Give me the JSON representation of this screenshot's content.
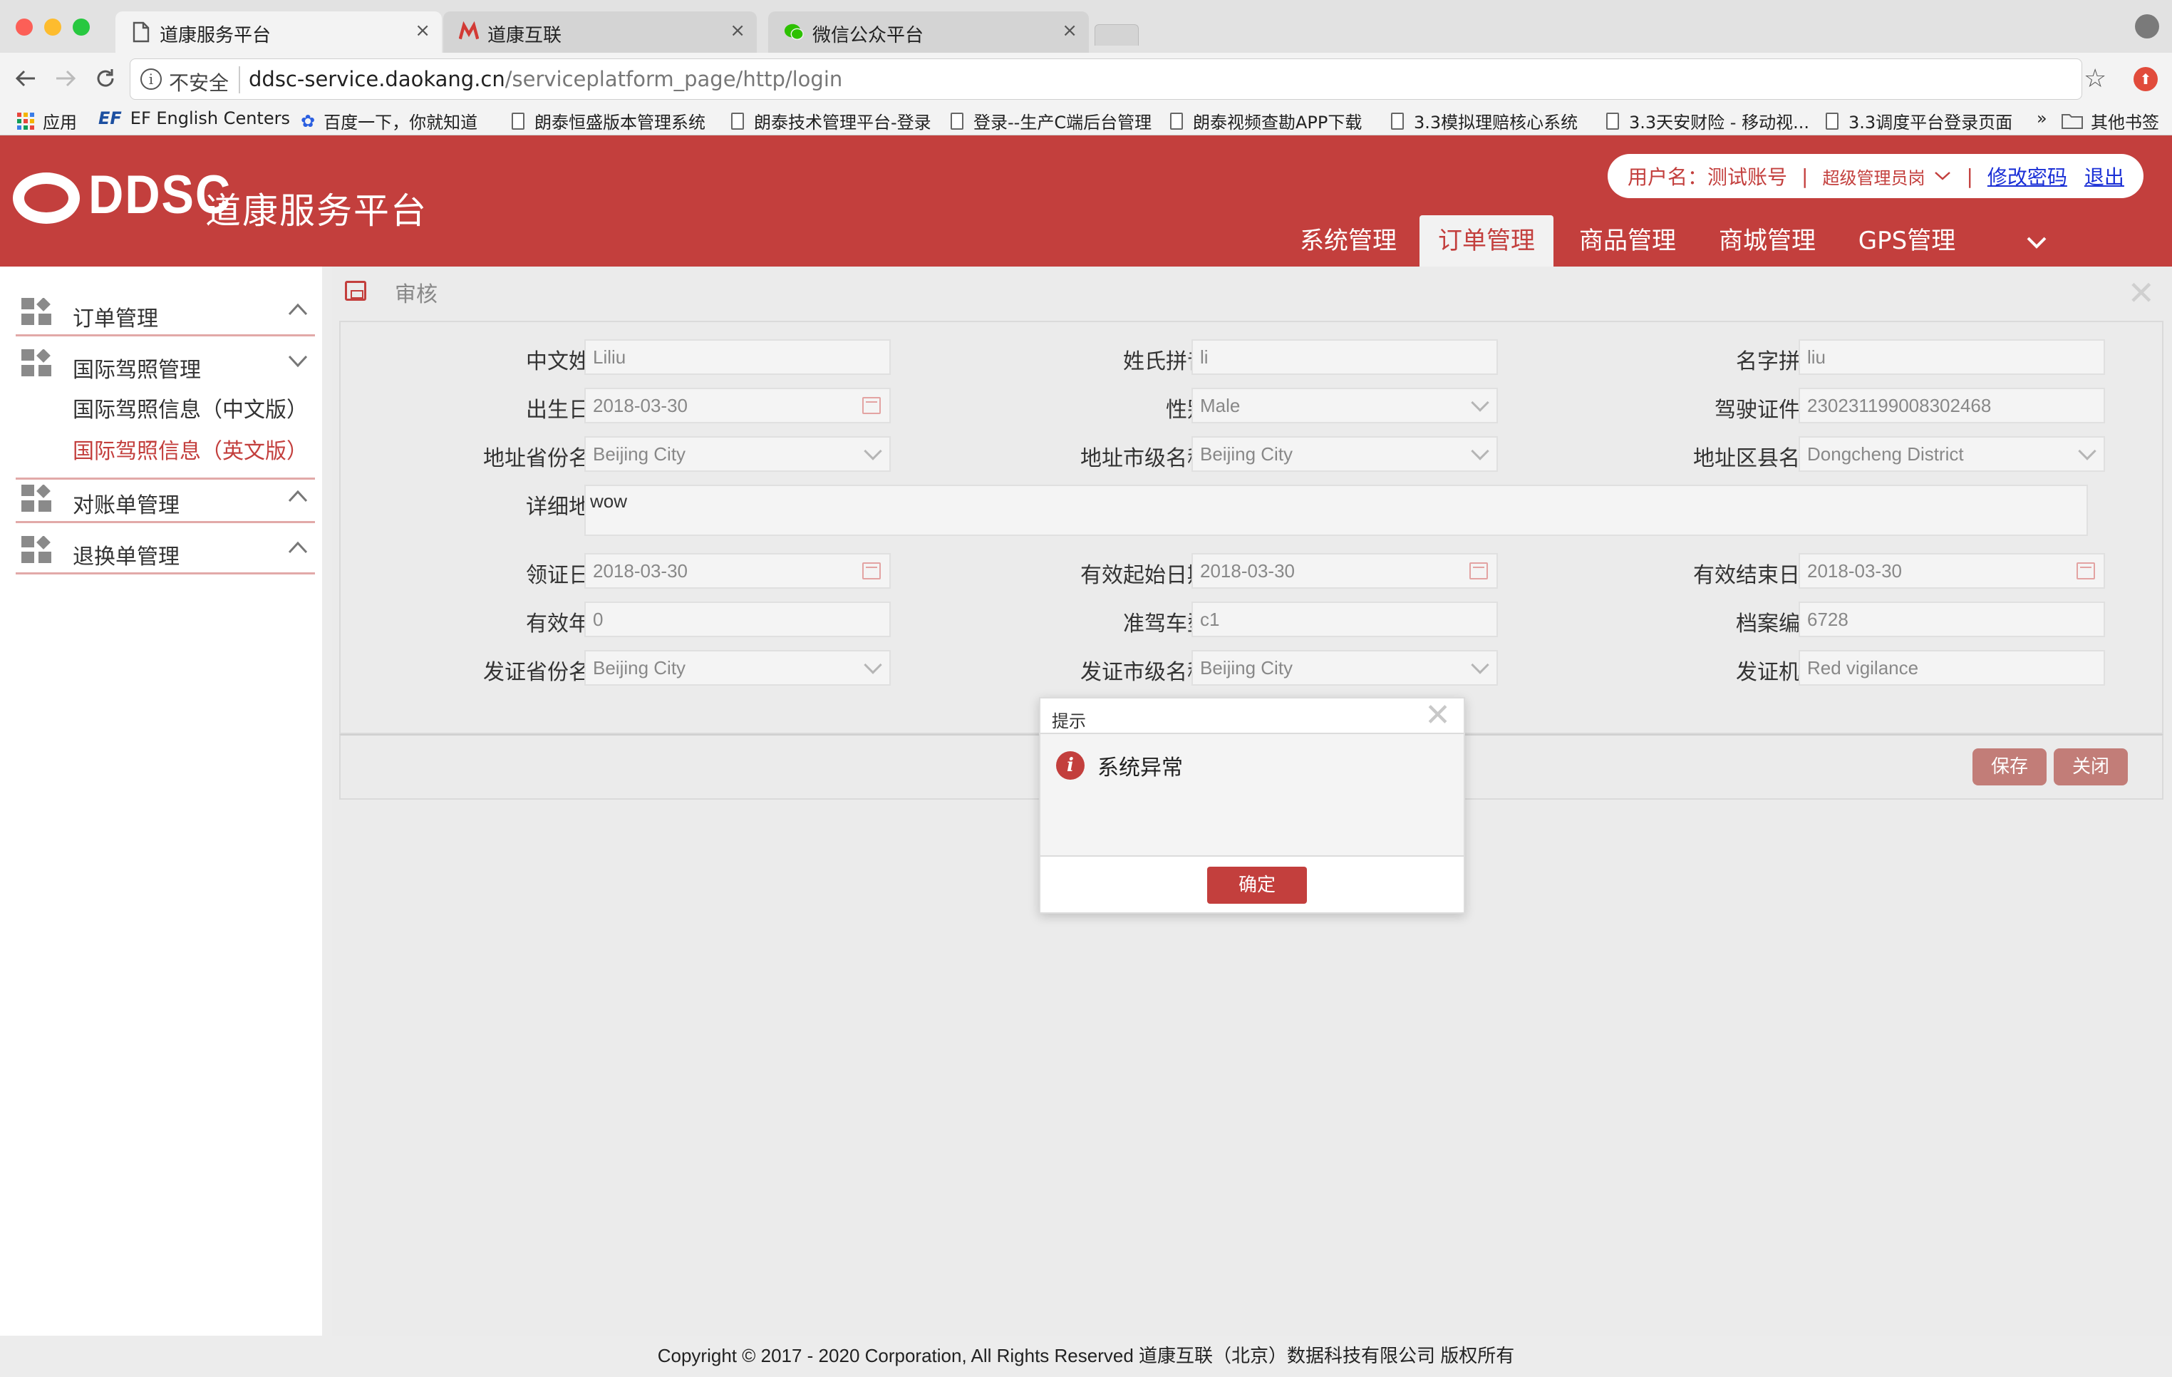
{
  "browser": {
    "tabs": [
      {
        "title": "道康服务平台",
        "active": true
      },
      {
        "title": "道康互联",
        "active": false
      },
      {
        "title": "微信公众平台",
        "active": false
      }
    ],
    "close_glyph": "×",
    "security": "不安全",
    "url_host": "ddsc-service.daokang.cn",
    "url_path": "/serviceplatform_page/http/login",
    "bookmarks": [
      "应用",
      "EF English Centers",
      "百度一下，你就知道",
      "朗泰恒盛版本管理系统",
      "朗泰技术管理平台-登录",
      "登录--生产C端后台管理",
      "朗泰视频查勘APP下载",
      "3.3模拟理赔核心系统",
      "3.3天安财险 - 移动视...",
      "3.3调度平台登录页面"
    ],
    "bookmarks_more": "»",
    "other_bookmarks": "其他书签",
    "icons": {
      "ef": "EF",
      "info": "i"
    }
  },
  "header": {
    "logo_text": "DDSC",
    "logo_cn": "道康服务平台",
    "user_label": "用户名：测试账号",
    "separator": "|",
    "role": "超级管理员岗",
    "change_password": "修改密码",
    "logout": "退出",
    "nav": [
      "系统管理",
      "订单管理",
      "商品管理",
      "商城管理",
      "GPS管理"
    ],
    "active_nav": "订单管理"
  },
  "sidebar": {
    "groups": [
      {
        "label": "订单管理",
        "expanded": false
      },
      {
        "label": "国际驾照管理",
        "expanded": true
      },
      {
        "label": "对账单管理",
        "expanded": false
      },
      {
        "label": "退换单管理",
        "expanded": false
      }
    ],
    "subitems": [
      "国际驾照信息（中文版）",
      "国际驾照信息（英文版）"
    ],
    "active_subitem": "国际驾照信息（英文版）"
  },
  "panel": {
    "title": "审核",
    "close_glyph": "✕"
  },
  "form": {
    "chinese_name": {
      "label": "中文姓名：",
      "value": "Liliu"
    },
    "surname_pinyin": {
      "label": "姓氏拼音：",
      "value": "li"
    },
    "given_pinyin": {
      "label": "名字拼音：",
      "value": "liu"
    },
    "birth_date": {
      "label": "出生日期：",
      "value": "2018-03-30"
    },
    "gender": {
      "label": "性别：",
      "value": "Male"
    },
    "license_no": {
      "label": "驾驶证件号：",
      "value": "230231199008302468"
    },
    "addr_province": {
      "label": "地址省份名称：",
      "value": "Beijing City"
    },
    "addr_city": {
      "label": "地址市级名称：",
      "value": "Beijing City"
    },
    "addr_district": {
      "label": "地址区县名称：",
      "value": "Dongcheng District"
    },
    "address": {
      "label": "详细地址：",
      "value": "wow"
    },
    "issue_date": {
      "label": "领证日期：",
      "value": "2018-03-30"
    },
    "valid_start": {
      "label": "有效起始日期：",
      "value": "2018-03-30"
    },
    "valid_end": {
      "label": "有效结束日期：",
      "value": "2018-03-30"
    },
    "valid_years": {
      "label": "有效年限：",
      "value": "0"
    },
    "vehicle_class": {
      "label": "准驾车型：",
      "value": "c1"
    },
    "file_no": {
      "label": "档案编号：",
      "value": "6728"
    },
    "issue_province": {
      "label": "发证省份名称：",
      "value": "Beijing City"
    },
    "issue_city": {
      "label": "发证市级名称：",
      "value": "Beijing City"
    },
    "issuing_authority": {
      "label": "发证机构：",
      "value": "Red vigilance"
    }
  },
  "actions": {
    "save": "保存",
    "close": "关闭"
  },
  "modal": {
    "title": "提示",
    "message": "系统异常",
    "ok": "确定",
    "close_glyph": "✕",
    "icon_glyph": "i"
  },
  "footer": {
    "text": "Copyright © 2017 - 2020 Corporation, All Rights Reserved 道康互联（北京）数据科技有限公司 版权所有"
  },
  "colors": {
    "brand": "#c33f3d",
    "button_muted": "#c27d78",
    "link": "#1a2fd6"
  }
}
